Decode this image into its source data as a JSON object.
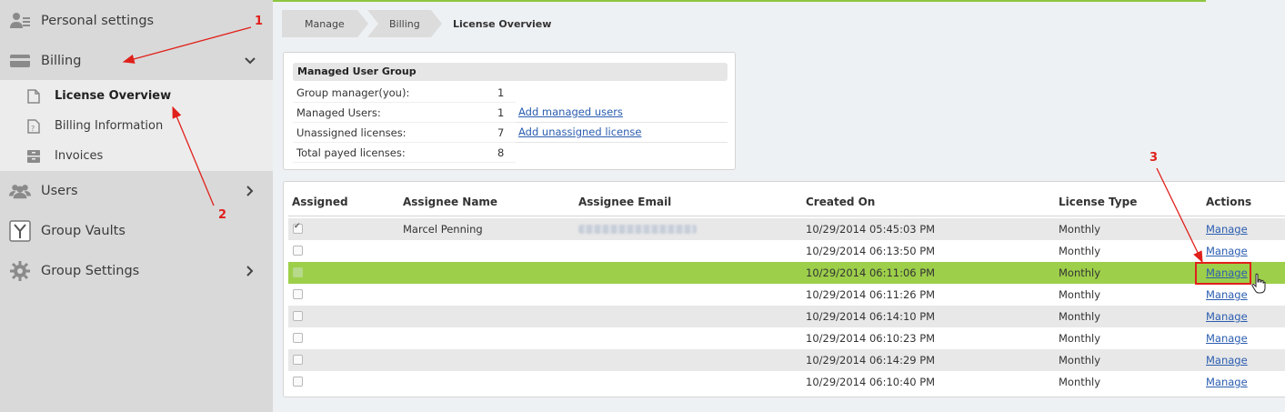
{
  "sidebar": {
    "items": [
      {
        "label": "Personal settings",
        "icon": "users-settings-icon"
      },
      {
        "label": "Billing",
        "icon": "credit-card-icon",
        "expanded": true
      },
      {
        "label": "Users",
        "icon": "users-icon"
      },
      {
        "label": "Group Vaults",
        "icon": "vault-icon"
      },
      {
        "label": "Group Settings",
        "icon": "gear-icon"
      }
    ],
    "billing_sub": [
      {
        "label": "License Overview",
        "icon": "document-icon",
        "active": true
      },
      {
        "label": "Billing Information",
        "icon": "document-question-icon"
      },
      {
        "label": "Invoices",
        "icon": "cabinet-icon"
      }
    ]
  },
  "breadcrumb": {
    "items": [
      "Manage",
      "Billing"
    ],
    "current": "License Overview"
  },
  "group": {
    "title": "Managed User Group",
    "rows": [
      {
        "label": "Group manager(you):",
        "value": "1",
        "link": ""
      },
      {
        "label": "Managed Users:",
        "value": "1",
        "link": "Add managed users"
      },
      {
        "label": "Unassigned licenses:",
        "value": "7",
        "link": "Add unassigned license"
      },
      {
        "label": "Total payed licenses:",
        "value": "8",
        "link": ""
      }
    ]
  },
  "table": {
    "headers": [
      "Assigned",
      "Assignee Name",
      "Assignee Email",
      "Created On",
      "License Type",
      "Actions"
    ],
    "rows": [
      {
        "assigned": true,
        "name": "Marcel Penning",
        "email_blurred": true,
        "created": "10/29/2014 05:45:03 PM",
        "type": "Monthly",
        "action": "Manage"
      },
      {
        "assigned": false,
        "name": "",
        "email_blurred": false,
        "created": "10/29/2014 06:13:50 PM",
        "type": "Monthly",
        "action": "Manage"
      },
      {
        "assigned": false,
        "name": "",
        "email_blurred": false,
        "created": "10/29/2014 06:11:06 PM",
        "type": "Monthly",
        "action": "Manage",
        "highlighted": true
      },
      {
        "assigned": false,
        "name": "",
        "email_blurred": false,
        "created": "10/29/2014 06:11:26 PM",
        "type": "Monthly",
        "action": "Manage"
      },
      {
        "assigned": false,
        "name": "",
        "email_blurred": false,
        "created": "10/29/2014 06:14:10 PM",
        "type": "Monthly",
        "action": "Manage"
      },
      {
        "assigned": false,
        "name": "",
        "email_blurred": false,
        "created": "10/29/2014 06:10:23 PM",
        "type": "Monthly",
        "action": "Manage"
      },
      {
        "assigned": false,
        "name": "",
        "email_blurred": false,
        "created": "10/29/2014 06:14:29 PM",
        "type": "Monthly",
        "action": "Manage"
      },
      {
        "assigned": false,
        "name": "",
        "email_blurred": false,
        "created": "10/29/2014 06:10:40 PM",
        "type": "Monthly",
        "action": "Manage"
      }
    ]
  },
  "annotations": {
    "step1": "1",
    "step2": "2",
    "step3": "3",
    "color": "#e0201b"
  },
  "colors": {
    "accent_green": "#9dcf4a",
    "link_blue": "#2a5db0",
    "sidebar_bg": "#d9d9d9"
  }
}
